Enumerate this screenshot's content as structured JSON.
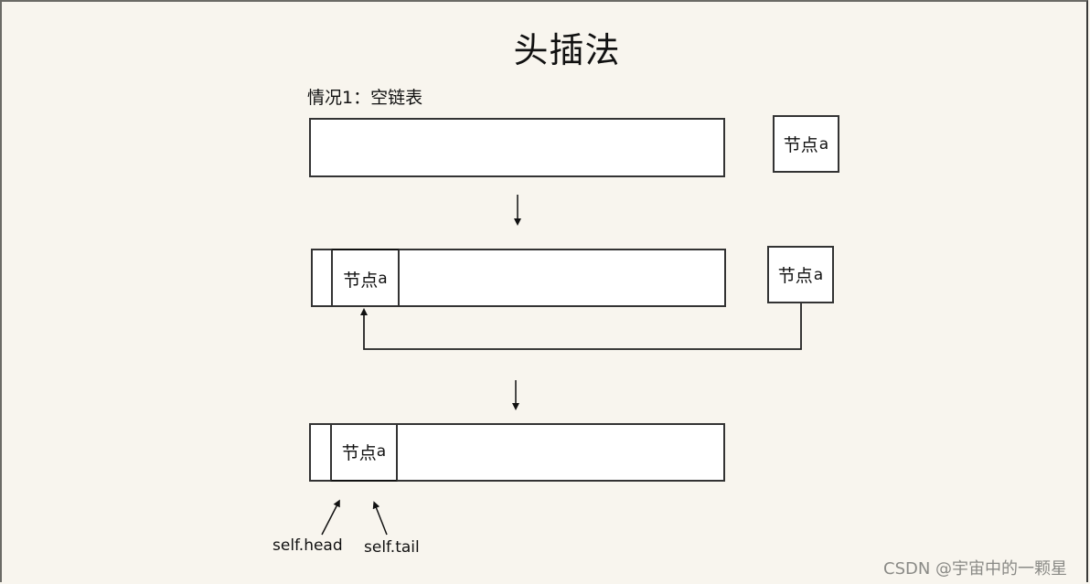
{
  "title": "头插法",
  "case_label": "情况1：空链表",
  "node_label_prefix": "节点",
  "node_label_suffix": "a",
  "steps": [
    {
      "name": "before",
      "list_nodes": [],
      "external_node": "节点a"
    },
    {
      "name": "inserting",
      "list_nodes": [
        "节点a"
      ],
      "external_node": "节点a",
      "connector": "external node links into head of list"
    },
    {
      "name": "after",
      "list_nodes": [
        "节点a"
      ],
      "external_node": null
    }
  ],
  "pointers": {
    "head": "self.head",
    "tail": "self.tail"
  },
  "watermark": "CSDN @宇宙中的一颗星",
  "colors": {
    "background": "#f8f5ee",
    "box_fill": "#ffffff",
    "stroke": "#333333",
    "watermark": "#8a8a86"
  }
}
